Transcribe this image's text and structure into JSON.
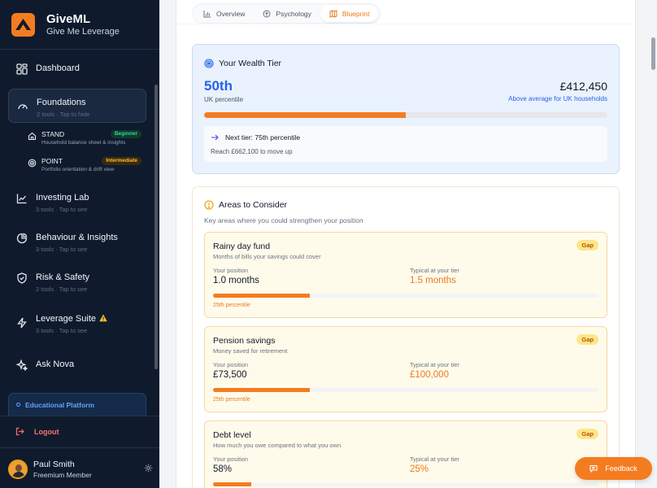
{
  "app": {
    "name": "GiveML",
    "tagline": "Give Me Leverage"
  },
  "sidebar": {
    "items": [
      {
        "label": "Dashboard"
      },
      {
        "label": "Foundations",
        "sub": "2 tools · Tap to hide"
      },
      {
        "label": "Investing Lab",
        "sub": "3 tools · Tap to see"
      },
      {
        "label": "Behaviour & Insights",
        "sub": "3 tools · Tap to see"
      },
      {
        "label": "Risk & Safety",
        "sub": "2 tools · Tap to see"
      },
      {
        "label": "Leverage Suite",
        "sub": "3 tools · Tap to see"
      },
      {
        "label": "Ask Nova"
      }
    ],
    "subitems": [
      {
        "label": "STAND",
        "desc": "Household balance sheet & insights",
        "badge": "Beginner"
      },
      {
        "label": "POINT",
        "desc": "Portfolio orientation & drift view",
        "badge": "Intermediate"
      }
    ],
    "edu_label": "Educational Platform",
    "logout_label": "Logout"
  },
  "user": {
    "name": "Paul Smith",
    "role": "Freemium Member"
  },
  "tabs": [
    {
      "label": "Overview"
    },
    {
      "label": "Psychology"
    },
    {
      "label": "Blueprint"
    }
  ],
  "tier": {
    "title": "Your Wealth Tier",
    "percentile": "50th",
    "percentile_caption": "UK percentile",
    "amount": "£412,450",
    "note": "Above average for UK households",
    "progress_fraction": 0.5,
    "next_title": "Next tier: 75th percentile",
    "next_sub": "Reach £662,100 to move up"
  },
  "areas": {
    "title": "Areas to Consider",
    "subtitle": "Key areas where you could strengthen your position",
    "your_label": "Your position",
    "typical_label": "Typical at your tier",
    "gap_label": "Gap",
    "metrics": [
      {
        "name": "Rainy day fund",
        "desc": "Months of bills your savings could cover",
        "your": "1.0 months",
        "typical": "1.5 months",
        "fraction": 0.25,
        "pct": "25th percentile"
      },
      {
        "name": "Pension savings",
        "desc": "Money saved for retirement",
        "your": "£73,500",
        "typical": "£100,000",
        "fraction": 0.25,
        "pct": "25th percentile"
      },
      {
        "name": "Debt level",
        "desc": "How much you owe compared to what you own",
        "your": "58%",
        "typical": "25%",
        "fraction": 0.1,
        "pct": ""
      }
    ]
  },
  "feedback_label": "Feedback",
  "colors": {
    "accent": "#f47c20",
    "sidebar_bg": "#0f1b2d",
    "tier_blue": "#2563eb",
    "danger": "#f87171"
  },
  "icons": [
    "dashboard-grid-icon",
    "gauge-icon",
    "home-icon",
    "target-icon",
    "chart-line-icon",
    "pie-chart-icon",
    "shield-icon",
    "lightning-icon",
    "warning-icon",
    "sparkle-icon",
    "logout-icon",
    "gear-icon",
    "bar-chart-icon",
    "brain-icon",
    "map-icon",
    "arrow-right-icon",
    "alert-circle-icon",
    "chat-icon"
  ]
}
